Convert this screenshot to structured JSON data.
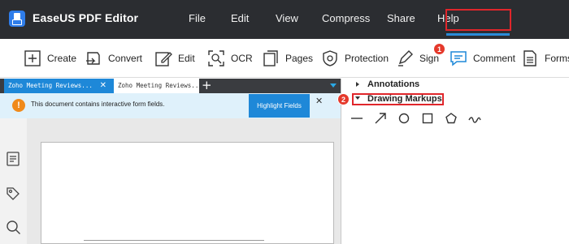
{
  "app": {
    "title": "EaseUS PDF Editor"
  },
  "menu": [
    "File",
    "Edit",
    "View",
    "Compress",
    "Share",
    "Help"
  ],
  "toolbar": {
    "create": "Create",
    "convert": "Convert",
    "edit": "Edit",
    "ocr": "OCR",
    "pages": "Pages",
    "protection": "Protection",
    "sign": "Sign",
    "comment": "Comment",
    "forms": "Forms"
  },
  "tabs": [
    {
      "label": "Zoho Meeting Reviews...",
      "close": "✕"
    },
    {
      "label": "Zoho Meeting Reviews..."
    }
  ],
  "tab_add": "+",
  "notice": {
    "icon": "!",
    "text": "This document contains interactive form fields.",
    "button": "Highlight Fields",
    "close": "✕"
  },
  "panel": {
    "annotations": "Annotations",
    "drawing_markups": "Drawing Markups",
    "tools": [
      "line-icon",
      "arrow-icon",
      "circle-icon",
      "rectangle-icon",
      "pentagon-icon",
      "freehand-icon"
    ]
  },
  "steps": {
    "one": "1",
    "two": "2"
  },
  "colors": {
    "accent": "#1e88d8",
    "highlight": "#e0262b",
    "titlebar": "#2b2d31"
  }
}
